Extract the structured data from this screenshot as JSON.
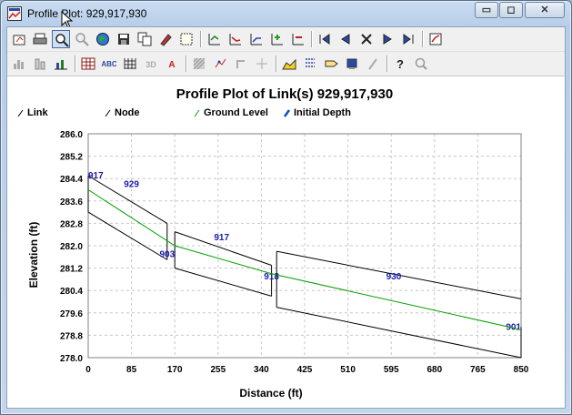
{
  "window": {
    "title": "Profile Plot: 929,917,930",
    "controls": {
      "minimize": "▭",
      "maximize": "◻",
      "close": "✕"
    }
  },
  "toolbar_row1": [
    {
      "name": "copy-to-clipboard-icon"
    },
    {
      "name": "print-icon"
    },
    {
      "name": "zoom-in-icon",
      "active": true
    },
    {
      "name": "zoom-out-icon"
    },
    {
      "name": "globe-icon"
    },
    {
      "name": "save-icon"
    },
    {
      "name": "copy-icon"
    },
    {
      "name": "edit-icon"
    },
    {
      "name": "grid-icon"
    },
    {
      "name": "sep"
    },
    {
      "name": "add-series-icon"
    },
    {
      "name": "series-icon-2"
    },
    {
      "name": "series-icon-3"
    },
    {
      "name": "add-point-icon"
    },
    {
      "name": "remove-point-icon"
    },
    {
      "name": "sep"
    },
    {
      "name": "first-icon"
    },
    {
      "name": "previous-icon"
    },
    {
      "name": "delete-icon"
    },
    {
      "name": "next-icon"
    },
    {
      "name": "last-icon"
    },
    {
      "name": "sep"
    },
    {
      "name": "customize-icon"
    }
  ],
  "toolbar_row2": [
    {
      "name": "bar-chart-icon"
    },
    {
      "name": "3d-bar-icon"
    },
    {
      "name": "line-bar-icon"
    },
    {
      "name": "sep"
    },
    {
      "name": "data-table-icon"
    },
    {
      "name": "font-abc-icon"
    },
    {
      "name": "grid-lines-icon"
    },
    {
      "name": "3d-icon"
    },
    {
      "name": "text-size-icon"
    },
    {
      "name": "sep"
    },
    {
      "name": "pattern-icon"
    },
    {
      "name": "markers-icon"
    },
    {
      "name": "rotate-icon"
    },
    {
      "name": "crosshair-icon"
    },
    {
      "name": "sep"
    },
    {
      "name": "area-chart-icon"
    },
    {
      "name": "legend-icon"
    },
    {
      "name": "tag-icon"
    },
    {
      "name": "paint-icon"
    },
    {
      "name": "pen-icon"
    },
    {
      "name": "sep"
    },
    {
      "name": "help-icon"
    },
    {
      "name": "search-icon"
    }
  ],
  "chart_data": {
    "type": "line",
    "title": "Profile Plot of Link(s) 929,917,930",
    "xlabel": "Distance (ft)",
    "ylabel": "Elevation (ft)",
    "xlim": [
      0,
      850
    ],
    "ylim": [
      278.0,
      286.0
    ],
    "xticks": [
      "0",
      "85",
      "170",
      "255",
      "340",
      "425",
      "510",
      "595",
      "680",
      "765",
      "850"
    ],
    "yticks": [
      "278.0",
      "278.8",
      "279.6",
      "280.4",
      "281.2",
      "282.0",
      "282.8",
      "283.6",
      "284.4",
      "285.2",
      "286.0"
    ],
    "grid": true,
    "legend_position": "top",
    "legend": [
      {
        "label": "Link",
        "color": "#000000"
      },
      {
        "label": "Node",
        "color": "#000000"
      },
      {
        "label": "Ground Level",
        "color": "#00a000"
      },
      {
        "label": "Initial Depth",
        "color": "#0050c8"
      }
    ],
    "nodes": [
      {
        "label": "917",
        "x": 0,
        "invert": 283.2,
        "top": 284.5,
        "label_y": 284.4
      },
      {
        "label": "903",
        "x": 155,
        "invert": 281.5,
        "top": 282.8,
        "label_y": 281.6
      },
      {
        "label": "903",
        "x": 170,
        "invert": 281.2,
        "top": 282.5
      },
      {
        "label": "918",
        "x": 360,
        "invert": 280.2,
        "top": 281.3,
        "label_y": 280.8
      },
      {
        "label": "918",
        "x": 370,
        "invert": 279.8,
        "top": 281.8
      },
      {
        "label": "901",
        "x": 850,
        "invert": 278.0,
        "top": 279.1,
        "label_y": 279.0
      }
    ],
    "links": [
      {
        "label": "929",
        "x1": 0,
        "x2": 155,
        "bottom1": 283.2,
        "bottom2": 281.5,
        "top1": 284.5,
        "top2": 282.8,
        "label_x": 85,
        "label_y": 284.1
      },
      {
        "label": "917",
        "x1": 170,
        "x2": 360,
        "bottom1": 281.2,
        "bottom2": 280.2,
        "top1": 282.5,
        "top2": 281.3,
        "label_x": 262,
        "label_y": 282.2
      },
      {
        "label": "930",
        "x1": 370,
        "x2": 850,
        "bottom1": 279.8,
        "bottom2": 278.0,
        "top1": 281.8,
        "top2": 280.1,
        "label_x": 600,
        "label_y": 280.8
      }
    ],
    "ground_level": {
      "x": [
        0,
        170,
        360,
        850
      ],
      "y": [
        284.0,
        282.0,
        281.0,
        279.0
      ]
    }
  }
}
